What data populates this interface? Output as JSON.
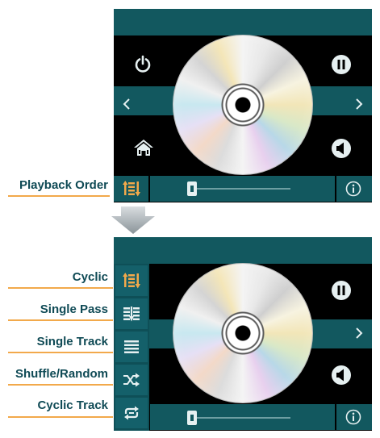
{
  "labels": {
    "playback_order": "Playback Order"
  },
  "order_modes": [
    {
      "label": "Cyclic",
      "icon": "cyclic-icon"
    },
    {
      "label": "Single Pass",
      "icon": "single-pass-icon"
    },
    {
      "label": "Single Track",
      "icon": "single-track-icon"
    },
    {
      "label": "Shuffle/Random",
      "icon": "shuffle-icon"
    },
    {
      "label": "Cyclic Track",
      "icon": "cyclic-track-icon"
    }
  ],
  "colors": {
    "teal": "#12585f",
    "accent_orange": "#f2a94b",
    "label_text": "#0f4a55",
    "icon_light": "#e6f0f1"
  },
  "seek": {
    "position": 0.0
  }
}
